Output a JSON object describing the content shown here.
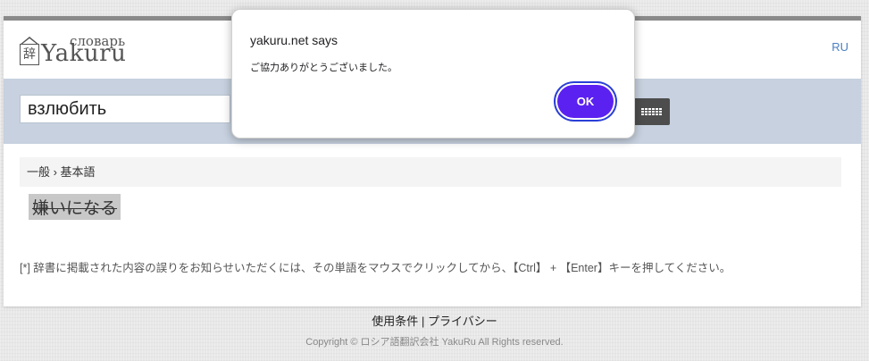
{
  "header": {
    "logo_kanji": "辞",
    "logo_small": "словарь",
    "logo_word": "Yakuru",
    "lang": "RU"
  },
  "search": {
    "value": "взлюбить"
  },
  "content": {
    "breadcrumb": "一般 › 基本語",
    "term": "嫌いになる",
    "note": "[*] 辞書に掲載された内容の誤りをお知らせいただくには、その単語をマウスでクリックしてから、【Ctrl】 + 【Enter】キーを押してください。"
  },
  "footer": {
    "terms": "使用条件",
    "separator": "|",
    "privacy": "プライバシー",
    "copyright": "Copyright © ロシア語翻訳会社 YakuRu All Rights reserved."
  },
  "dialog": {
    "title": "yakuru.net says",
    "message": "ご協力ありがとうございました。",
    "ok_label": "OK"
  },
  "colors": {
    "accent": "#5b21f0",
    "searchbar_bg": "#c7d1df",
    "link": "#4a7fc1"
  }
}
